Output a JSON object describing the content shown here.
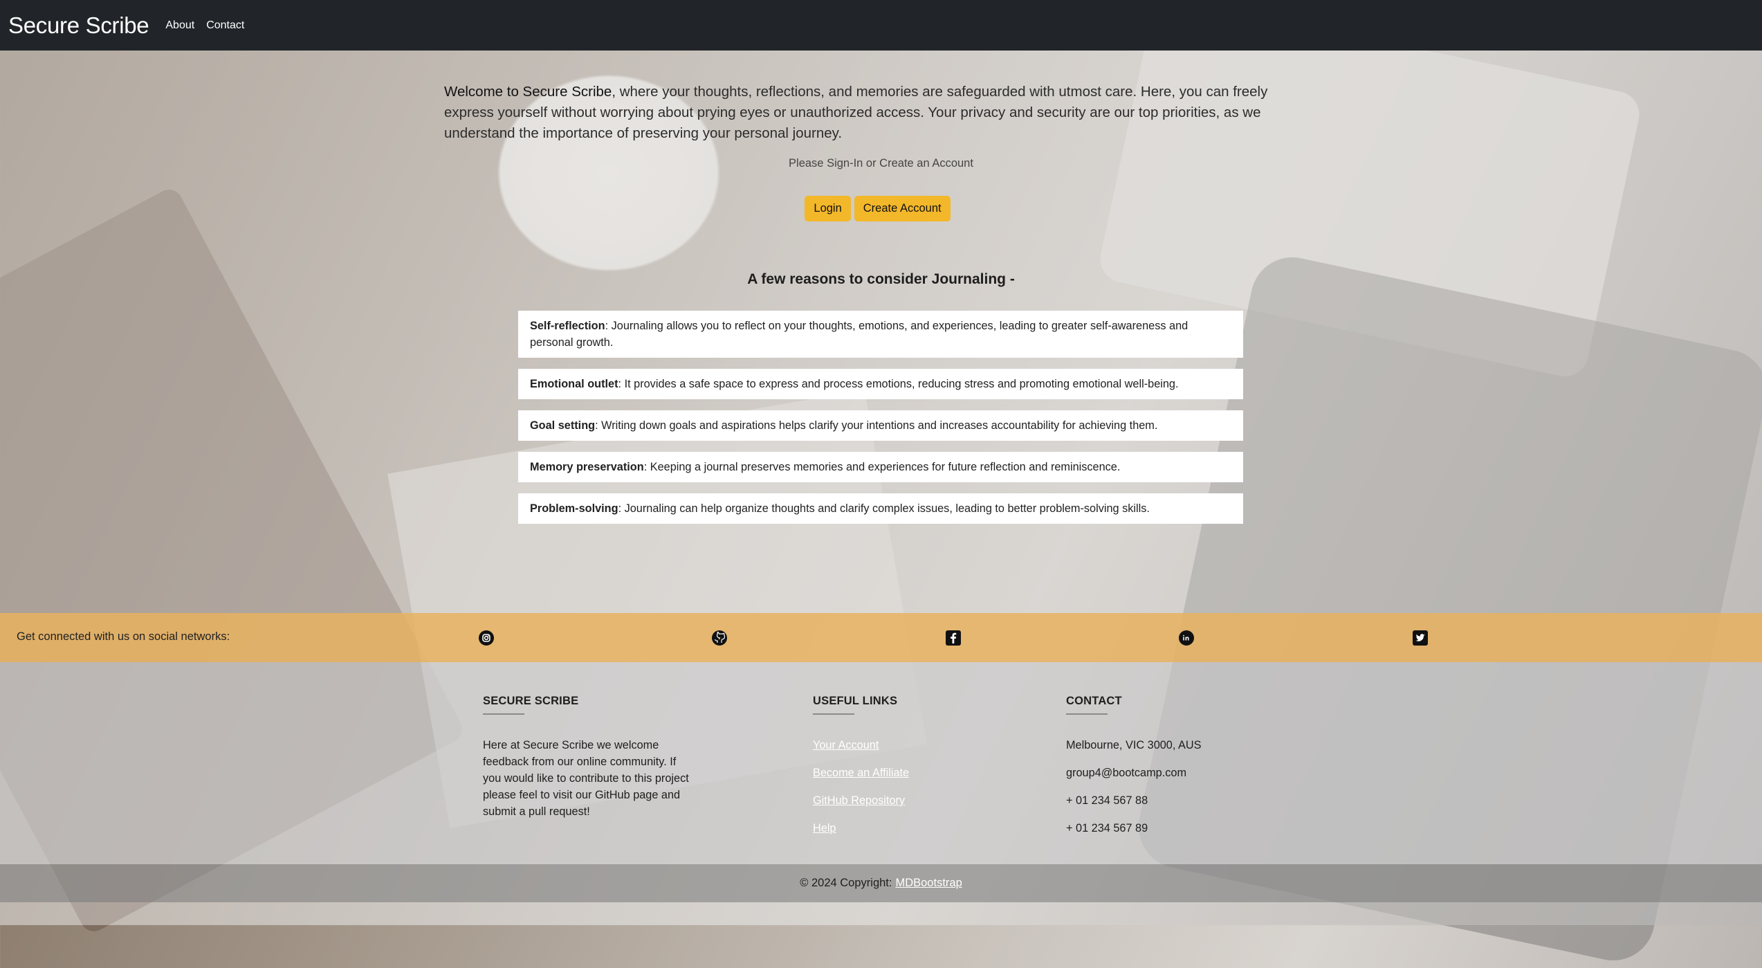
{
  "navbar": {
    "brand": "Secure Scribe",
    "links": [
      "About",
      "Contact"
    ]
  },
  "intro": {
    "lead": "Welcome to Secure Scribe",
    "body": ", where your thoughts, reflections, and memories are safeguarded with utmost care. Here, you can freely express yourself without worrying about prying eyes or unauthorized access. Your privacy and security are our top priorities, as we understand the importance of preserving your personal journey."
  },
  "auth": {
    "prompt": "Please Sign-In or Create an Account",
    "login_label": "Login",
    "create_label": "Create Account",
    "button_color": "#f3b72a"
  },
  "reasons": {
    "title": "A few reasons to consider Journaling -",
    "items": [
      {
        "term": "Self-reflection",
        "text": ": Journaling allows you to reflect on your thoughts, emotions, and experiences, leading to greater self-awareness and personal growth."
      },
      {
        "term": "Emotional outlet",
        "text": ": It provides a safe space to express and process emotions, reducing stress and promoting emotional well-being."
      },
      {
        "term": "Goal setting",
        "text": ": Writing down goals and aspirations helps clarify your intentions and increases accountability for achieving them."
      },
      {
        "term": "Memory preservation",
        "text": ": Keeping a journal preserves memories and experiences for future reflection and reminiscence."
      },
      {
        "term": "Problem-solving",
        "text": ": Journaling can help organize thoughts and clarify complex issues, leading to better problem-solving skills."
      }
    ]
  },
  "social": {
    "text": "Get connected with us on social networks:",
    "icons": [
      "instagram-icon",
      "github-icon",
      "facebook-icon",
      "linkedin-icon",
      "twitter-icon"
    ],
    "bar_color": "#e8b15f"
  },
  "footer": {
    "about": {
      "heading": "SECURE SCRIBE",
      "text": "Here at Secure Scribe we welcome feedback from our online community. If you would like to contribute to this project please feel to visit our GitHub page and submit a pull request!"
    },
    "links": {
      "heading": "USEFUL LINKS",
      "items": [
        "Your Account",
        "Become an Affiliate",
        "GitHub Repository",
        "Help"
      ]
    },
    "contact": {
      "heading": "CONTACT",
      "address": "Melbourne, VIC 3000, AUS",
      "email": "group4@bootcamp.com",
      "phone1": "+ 01 234 567 88",
      "phone2": "+ 01 234 567 89"
    },
    "copyright_text": "© 2024 Copyright:",
    "copyright_link": "MDBootstrap"
  }
}
